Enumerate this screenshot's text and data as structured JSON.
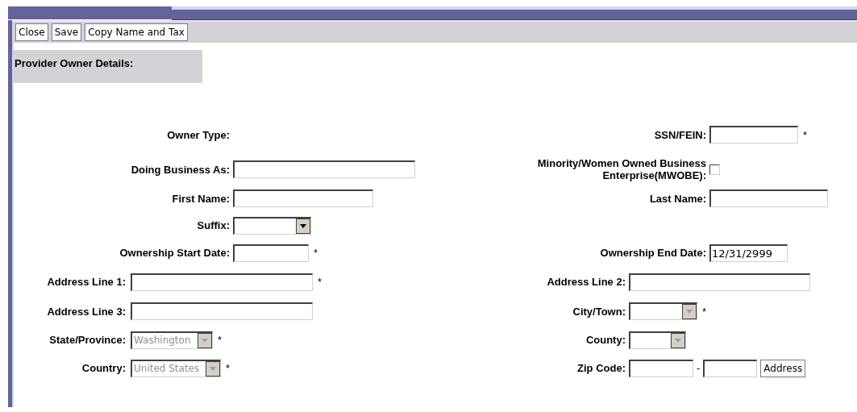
{
  "toolbar": {
    "buttons": [
      "Close",
      "Save",
      "Copy Name and Tax"
    ]
  },
  "section_title": "Provider Owner Details:",
  "upper_rows": [
    {
      "left": {
        "label": "Owner Type:",
        "kind": "none"
      },
      "right": {
        "label": "SSN/FEIN:",
        "kind": "text",
        "required_mark": "*"
      }
    },
    {
      "left": {
        "label": "Doing Business As:",
        "kind": "text"
      },
      "right": {
        "label": "Minority/Women Owned Business Enterprise(MWOBE):",
        "kind": "checkbox",
        "checked": false
      }
    },
    {
      "left": {
        "label": "First Name:",
        "kind": "text"
      },
      "right": {
        "label": "Last Name:",
        "kind": "text"
      }
    },
    {
      "left": {
        "label": "Suffix:",
        "kind": "select",
        "disabled": false
      }
    },
    {
      "left": {
        "label": "Ownership Start Date:",
        "kind": "text",
        "required_mark": "*"
      },
      "right": {
        "label": "Ownership End Date:",
        "kind": "text",
        "value": "12/31/2999"
      }
    }
  ],
  "lower_rows": [
    {
      "left": {
        "label": "Address Line 1:",
        "kind": "text",
        "required_mark": "*"
      },
      "right": {
        "label": "Address Line 2:",
        "kind": "text"
      }
    },
    {
      "left": {
        "label": "Address Line 3:",
        "kind": "text"
      },
      "right": {
        "label": "City/Town:",
        "kind": "select",
        "disabled": true,
        "required_mark": "*"
      }
    },
    {
      "left": {
        "label": "State/Province:",
        "kind": "select",
        "value": "Washington",
        "disabled": true,
        "required_mark": "*"
      },
      "right": {
        "label": "County:",
        "kind": "select",
        "disabled": true
      }
    },
    {
      "left": {
        "label": "Country:",
        "kind": "select",
        "value": "United States",
        "disabled": true,
        "required_mark": "*"
      },
      "right": {
        "label": "Zip Code:",
        "kind": "zip",
        "separator": "-",
        "button": "Address"
      }
    }
  ]
}
